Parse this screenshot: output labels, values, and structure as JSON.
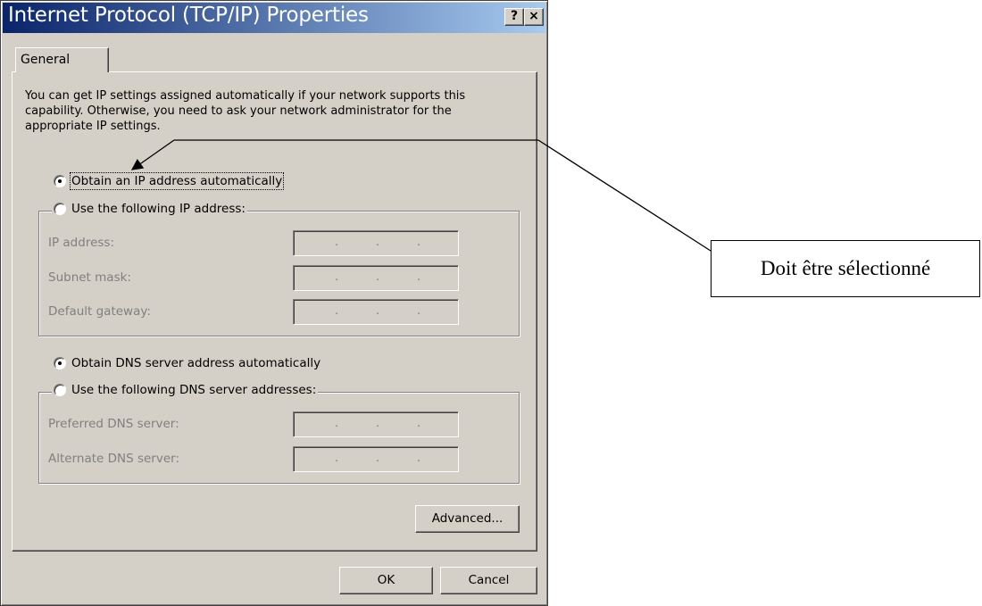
{
  "window": {
    "title": "Internet Protocol (TCP/IP) Properties",
    "help_label": "?",
    "close_label": "×"
  },
  "tabs": [
    {
      "label": "General"
    }
  ],
  "intro_text": "You can get IP settings assigned automatically if your network supports this capability. Otherwise, you need to ask your network administrator for the appropriate IP settings.",
  "ip": {
    "auto_label": "Obtain an IP address automatically",
    "manual_label": "Use the following IP address:",
    "selected": "auto",
    "fields": [
      {
        "label": "IP address:"
      },
      {
        "label": "Subnet mask:"
      },
      {
        "label": "Default gateway:"
      }
    ]
  },
  "dns": {
    "auto_label": "Obtain DNS server address automatically",
    "manual_label": "Use the following DNS server addresses:",
    "selected": "auto",
    "fields": [
      {
        "label": "Preferred DNS server:"
      },
      {
        "label": "Alternate DNS server:"
      }
    ]
  },
  "ip_separator": ".",
  "buttons": {
    "advanced": "Advanced...",
    "ok": "OK",
    "cancel": "Cancel"
  },
  "annotation": {
    "text": "Doit être sélectionné"
  }
}
